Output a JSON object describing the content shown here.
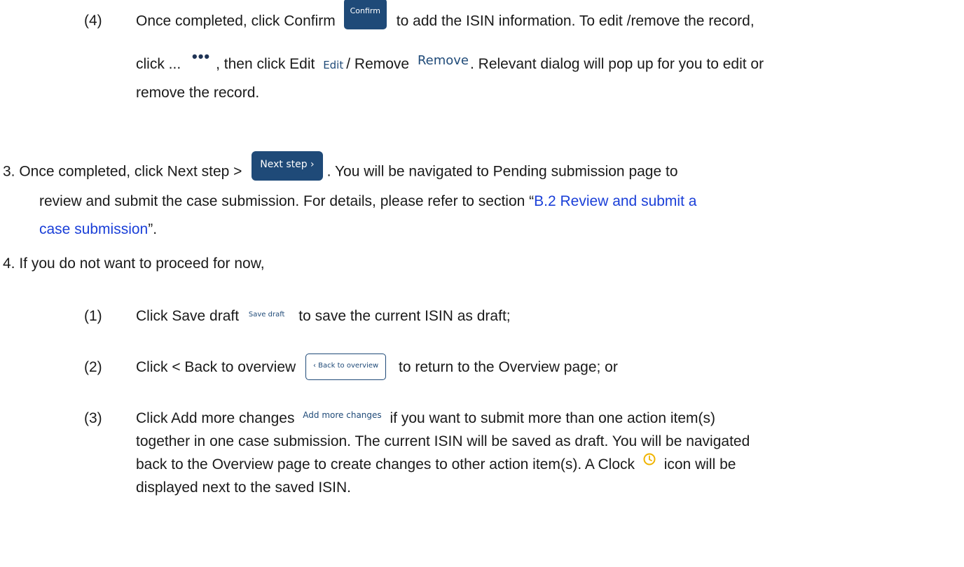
{
  "step4_sub4": {
    "num": "(4)",
    "t1": "Once completed, click Confirm ",
    "confirm_btn": "Confirm",
    "t2": " to add the ISIN information. To edit /remove the record,",
    "l2_t1": "click ... ",
    "dots": "•••",
    "l2_t2": ", then click Edit ",
    "edit_label": "Edit",
    "l2_t3": "/ Remove ",
    "remove_label": "Remove",
    "l2_t4": ". Relevant dialog will pop up for you to edit or",
    "l3": "remove the record."
  },
  "step3": {
    "t1": "3. Once completed, click Next step > ",
    "next_btn": "Next step  ›",
    "t2": ". You will be navigated to Pending submission page to",
    "l2_t1": "review and submit the case submission. For details, please refer to section “",
    "link1": "B.2 Review and submit a",
    "link2": "case submission",
    "l3_t2": "”."
  },
  "step4": {
    "t1": "4. If you do not want to proceed for now,"
  },
  "sub1": {
    "num": "(1)",
    "t1": "Click Save draft ",
    "save_label": "Save draft",
    "t2": " to save the current ISIN as draft;"
  },
  "sub2": {
    "num": "(2)",
    "t1": "Click < Back to overview ",
    "back_btn": "‹  Back to overview",
    "t2": " to return to the Overview page; or"
  },
  "sub3": {
    "num": "(3)",
    "t1": "Click Add more changes ",
    "addmore_label": "Add more changes",
    "t2": " if you want to submit more than one action item(s)",
    "l2": "together in one case submission. The current ISIN will be saved as draft. You will be navigated",
    "l3_t1": "back to the Overview page to create changes to other action item(s). A Clock ",
    "l3_t2": " icon will be",
    "l4": "displayed next to the saved ISIN."
  },
  "colors": {
    "link": "#1a3fd8",
    "button": "#1f4a78",
    "clock": "#f0b400"
  },
  "icons": [
    "more-dots-icon",
    "clock-icon"
  ]
}
